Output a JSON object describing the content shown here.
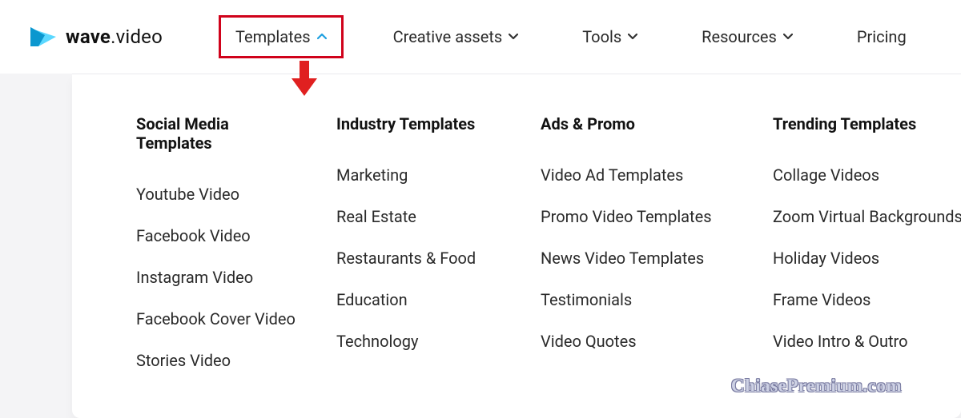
{
  "brand": {
    "text_bold": "wave",
    "text_light": ".video"
  },
  "nav": {
    "items": [
      {
        "label": "Templates",
        "arrow": "up",
        "highlight": true
      },
      {
        "label": "Creative assets",
        "arrow": "down"
      },
      {
        "label": "Tools",
        "arrow": "down"
      },
      {
        "label": "Resources",
        "arrow": "down"
      },
      {
        "label": "Pricing",
        "arrow": "none"
      }
    ]
  },
  "dropdown": {
    "columns": [
      {
        "heading": "Social Media Templates",
        "links": [
          "Youtube Video",
          "Facebook Video",
          "Instagram Video",
          "Facebook Cover Video",
          "Stories Video"
        ]
      },
      {
        "heading": "Industry Templates",
        "links": [
          "Marketing",
          "Real Estate",
          "Restaurants & Food",
          "Education",
          "Technology"
        ]
      },
      {
        "heading": "Ads & Promo",
        "links": [
          "Video Ad Templates",
          "Promo Video Templates",
          "News Video Templates",
          "Testimonials",
          "Video Quotes"
        ]
      },
      {
        "heading": "Trending Templates",
        "links": [
          "Collage Videos",
          "Zoom Virtual Backgrounds",
          "Holiday Videos",
          "Frame Videos",
          "Video Intro & Outro"
        ]
      }
    ]
  },
  "watermark": "ChiasePremium.com",
  "colors": {
    "highlight_border": "#d0021b",
    "arrow_fill": "#e02020",
    "brand_dark": "#0a91c9",
    "brand_light": "#3ec9ff"
  }
}
